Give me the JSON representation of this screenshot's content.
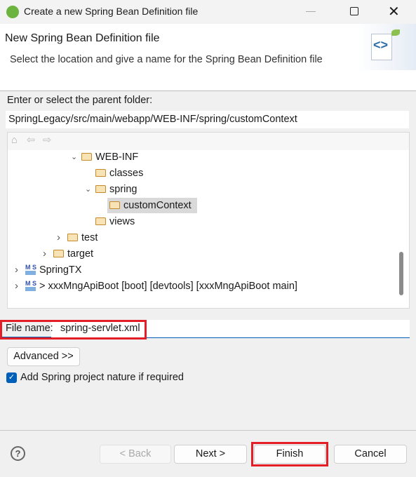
{
  "window": {
    "title": "Create a new Spring Bean Definition file"
  },
  "header": {
    "title": "New Spring Bean Definition file",
    "description": "Select the location and give a name for the Spring Bean Definition file"
  },
  "parent_folder": {
    "label": "Enter or select the parent folder:",
    "value": "SpringLegacy/src/main/webapp/WEB-INF/spring/customContext"
  },
  "tree": {
    "items": [
      {
        "label": "WEB-INF",
        "level": 4,
        "expanded": true,
        "icon": "folder-icon"
      },
      {
        "label": "classes",
        "level": 5,
        "icon": "folder-icon"
      },
      {
        "label": "spring",
        "level": 5,
        "expanded": true,
        "icon": "folder-icon"
      },
      {
        "label": "customContext",
        "level": 6,
        "icon": "folder-icon",
        "selected": true
      },
      {
        "label": "views",
        "level": 5,
        "icon": "folder-icon"
      },
      {
        "label": "test",
        "level": 3,
        "expanded": false,
        "icon": "folder-icon"
      },
      {
        "label": "target",
        "level": 2,
        "expanded": false,
        "icon": "folder-icon"
      },
      {
        "label": "SpringTX",
        "level": 0,
        "expanded": false,
        "icon": "spring-project-icon"
      },
      {
        "label": "> xxxMngApiBoot [boot] [devtools] [xxxMngApiBoot main]",
        "level": 0,
        "expanded": false,
        "icon": "spring-boot-project-icon"
      }
    ]
  },
  "file_name": {
    "label": "File name:",
    "value": "spring-servlet.xml"
  },
  "advanced_button": "Advanced >>",
  "spring_nature": {
    "label": "Add Spring project nature if required",
    "checked": true
  },
  "buttons": {
    "back": "< Back",
    "next": "Next >",
    "finish": "Finish",
    "cancel": "Cancel"
  },
  "colors": {
    "highlight": "#e41e26",
    "accent": "#005fb8"
  }
}
